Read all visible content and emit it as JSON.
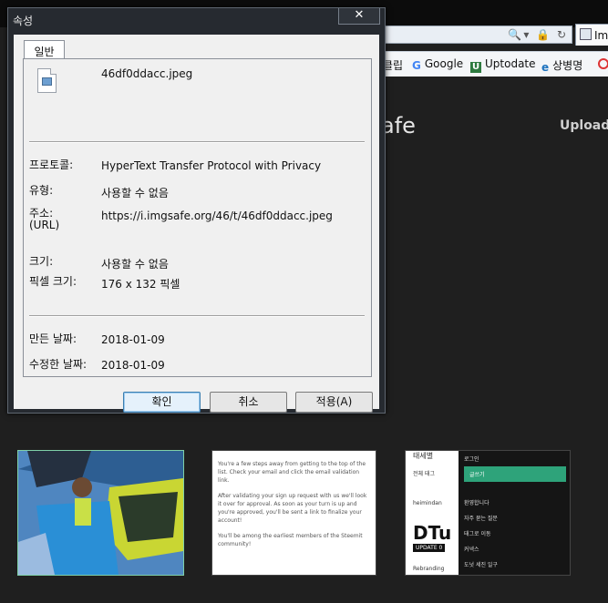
{
  "browser": {
    "tab_label": "Im",
    "favorites": [
      {
        "label": "클립",
        "icon": "folder-icon"
      },
      {
        "label": "Google",
        "icon": "google-icon"
      },
      {
        "label": "Uptodate",
        "icon": "uptodate-icon"
      },
      {
        "label": "상병명",
        "icon": "ie-icon"
      }
    ],
    "site_title": "afe",
    "upload_label": "Upload"
  },
  "dialog": {
    "title": "속성",
    "close_label": "✕",
    "tab": "일반",
    "file_name": "46df0ddacc.jpeg",
    "properties": {
      "protocol_label": "프로토콜:",
      "protocol_value": "HyperText Transfer Protocol with Privacy",
      "type_label": "유형:",
      "type_value": "사용할 수 없음",
      "address_label": "주소:",
      "address_label_2": "(URL)",
      "address_value": "https://i.imgsafe.org/46/t/46df0ddacc.jpeg",
      "size_label": "크기:",
      "size_value": "사용할 수 없음",
      "pixel_label": "픽셀 크기:",
      "pixel_value": "176 x 132 픽셀",
      "created_label": "만든 날짜:",
      "created_value": "2018-01-09",
      "modified_label": "수정한 날짜:",
      "modified_value": "2018-01-09"
    },
    "buttons": {
      "ok": "확인",
      "cancel": "취소",
      "apply": "적용(A)"
    }
  },
  "thumbnails": {
    "thumb2_paragraphs": [
      "You're a few steps away from getting to the top of the list. Check your email and click the email validation link.",
      "After validating your sign up request with us we'll look it over for approval. As soon as your turn is up and you're approved, you'll be sent a link to finalize your account!",
      "You'll be among the earliest members of the Steemit community!"
    ],
    "thumb3_menu": [
      "로그인",
      "글쓰기",
      "환영합니다",
      "자주 묻는 질문",
      "태그로 이동",
      "커넥스",
      "도넛 세진 일구"
    ],
    "thumb3_left": {
      "title": "태세별",
      "search": "전체 태그",
      "user": "heimindan",
      "logo": "DTu",
      "update": "UPDATE 0",
      "footer": "Rebranding"
    }
  },
  "colors": {
    "dialog_frame": "#262a30",
    "client_bg": "#f0f0f0",
    "page_bg": "#1f1f1f",
    "menu_highlight": "#2ea37a"
  }
}
